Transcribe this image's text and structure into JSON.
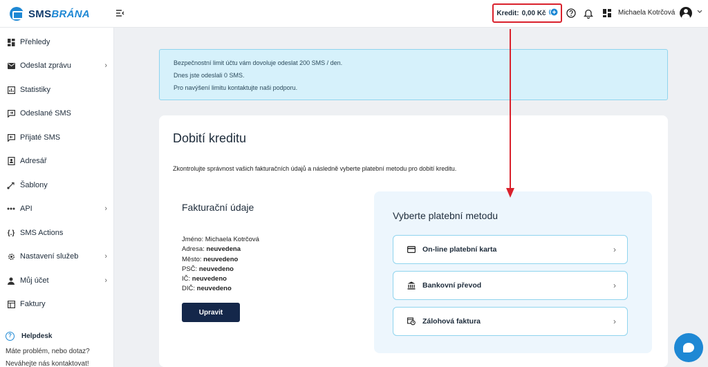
{
  "brand": {
    "prefix": "SMS",
    "suffix": "BRÁNA"
  },
  "header": {
    "credit_label": "Kredit:",
    "credit_value": "0,00 Kč",
    "user_name": "Michaela Kotrčová"
  },
  "sidebar": {
    "items": [
      {
        "label": "Přehledy",
        "icon": "dashboard-icon",
        "has_submenu": false
      },
      {
        "label": "Odeslat zprávu",
        "icon": "envelope-icon",
        "has_submenu": true
      },
      {
        "label": "Statistiky",
        "icon": "stats-icon",
        "has_submenu": false
      },
      {
        "label": "Odeslané SMS",
        "icon": "sent-sms-icon",
        "has_submenu": false
      },
      {
        "label": "Přijaté SMS",
        "icon": "received-sms-icon",
        "has_submenu": false
      },
      {
        "label": "Adresář",
        "icon": "address-book-icon",
        "has_submenu": false
      },
      {
        "label": "Šablony",
        "icon": "templates-icon",
        "has_submenu": false
      },
      {
        "label": "API",
        "icon": "api-icon",
        "has_submenu": true
      },
      {
        "label": "SMS Actions",
        "icon": "code-icon",
        "has_submenu": false
      },
      {
        "label": "Nastavení služeb",
        "icon": "settings-icon",
        "has_submenu": true
      },
      {
        "label": "Můj účet",
        "icon": "user-icon",
        "has_submenu": true
      },
      {
        "label": "Faktury",
        "icon": "invoice-icon",
        "has_submenu": false
      }
    ],
    "helpdesk_title": "Helpdesk",
    "help_line1": "Máte problém, nebo dotaz?",
    "help_line2": "Neváhejte nás kontaktovat!"
  },
  "alert": {
    "line1": "Bezpečnostní limit účtu vám dovoluje odeslat 200 SMS / den.",
    "line2": "Dnes jste odeslali 0 SMS.",
    "line3": "Pro navýšení limitu kontaktujte naši podporu."
  },
  "card": {
    "title": "Dobití kreditu",
    "description": "Zkontrolujte správnost vašich fakturačních údajů a následně vyberte platební metodu pro dobití kreditu."
  },
  "billing": {
    "title": "Fakturační údaje",
    "rows": [
      {
        "label": "Jméno:",
        "value": "Michaela Kotrčová",
        "bold": false
      },
      {
        "label": "Adresa:",
        "value": "neuvedena",
        "bold": true
      },
      {
        "label": "Město:",
        "value": "neuvedeno",
        "bold": true
      },
      {
        "label": "PSČ:",
        "value": "neuvedeno",
        "bold": true
      },
      {
        "label": "IČ:",
        "value": "neuvedeno",
        "bold": true
      },
      {
        "label": "DIČ:",
        "value": "neuvedeno",
        "bold": true
      }
    ],
    "edit_button": "Upravit"
  },
  "payment": {
    "title": "Vyberte platební metodu",
    "methods": [
      {
        "label": "On-line platební karta",
        "icon": "credit-card-icon"
      },
      {
        "label": "Bankovní převod",
        "icon": "bank-icon"
      },
      {
        "label": "Zálohová faktura",
        "icon": "invoice-clock-icon"
      }
    ]
  },
  "colors": {
    "brand_blue": "#1e88d4",
    "dark_navy": "#14274a",
    "highlight_red": "#d9212c",
    "alert_bg": "#d6f1fb",
    "panel_bg": "#edf6fd"
  }
}
